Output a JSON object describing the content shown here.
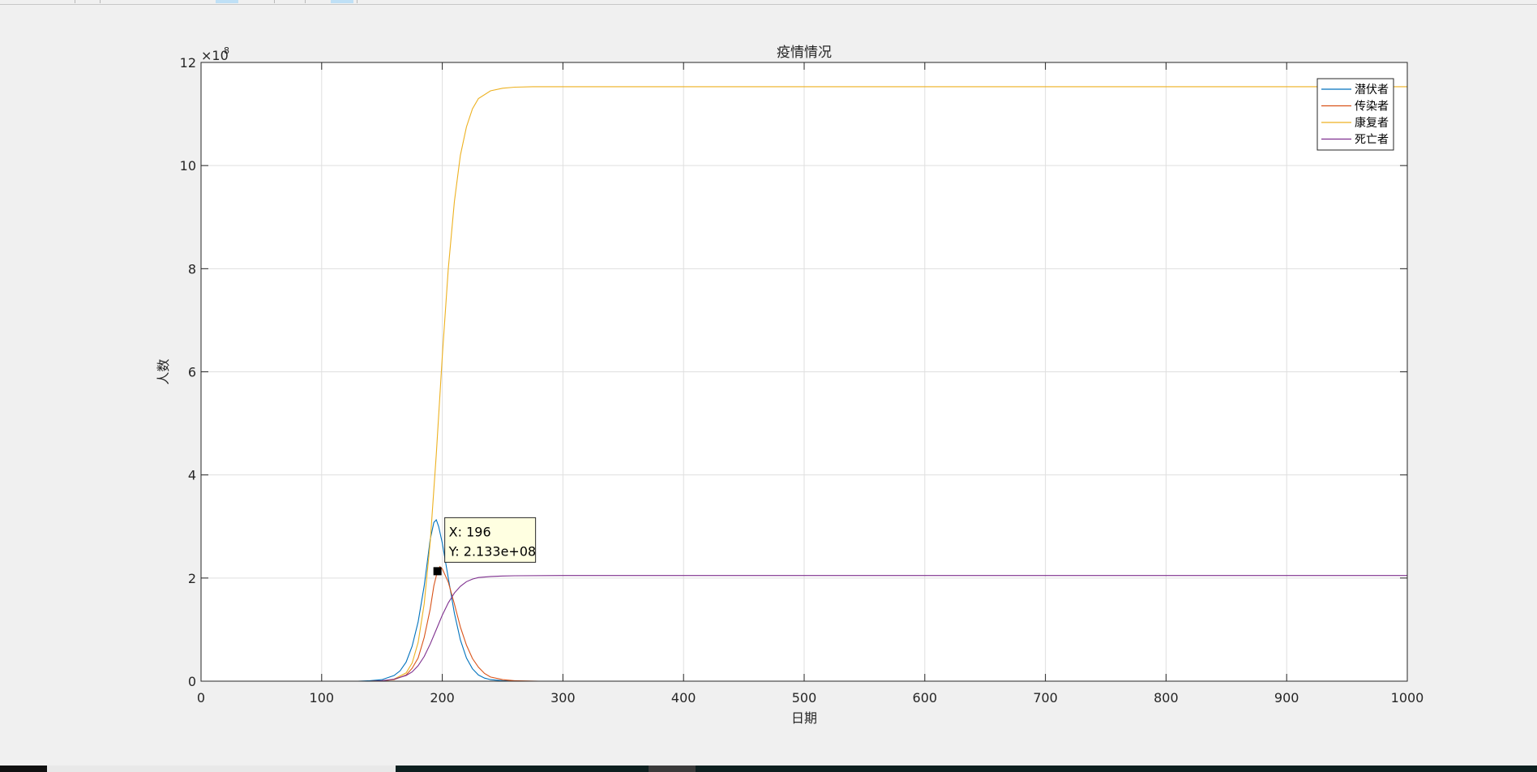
{
  "colors": {
    "series": [
      "#0072BD",
      "#D95319",
      "#EDB120",
      "#7E2F8E"
    ],
    "grid": "#dfdfdf",
    "axis": "#262626",
    "tooltip_bg": "#ffffe1",
    "background": "#f0f0f0"
  },
  "chart_data": {
    "type": "line",
    "title": "疫情情况",
    "xlabel": "日期",
    "ylabel": "人数",
    "y_exponent": "8",
    "y_multiplier_prefix": "×10",
    "xlim": [
      0,
      1000
    ],
    "ylim": [
      0,
      1200000000
    ],
    "grid": true,
    "legend_position": "top-right",
    "x_ticks": [
      0,
      100,
      200,
      300,
      400,
      500,
      600,
      700,
      800,
      900,
      1000
    ],
    "x_tick_labels": [
      "0",
      "100",
      "200",
      "300",
      "400",
      "500",
      "600",
      "700",
      "800",
      "900",
      "1000"
    ],
    "y_ticks": [
      0,
      200000000,
      400000000,
      600000000,
      800000000,
      1000000000,
      1200000000
    ],
    "y_tick_labels": [
      "0",
      "2",
      "4",
      "6",
      "8",
      "10",
      "12"
    ],
    "series": [
      {
        "name": "潜伏者",
        "color_index": 0,
        "points": [
          [
            20,
            0
          ],
          [
            130,
            0
          ],
          [
            140,
            1000000
          ],
          [
            150,
            3000000
          ],
          [
            160,
            11000000
          ],
          [
            165,
            20000000
          ],
          [
            170,
            37000000
          ],
          [
            175,
            68000000
          ],
          [
            180,
            115000000
          ],
          [
            185,
            185000000
          ],
          [
            190,
            275000000
          ],
          [
            193,
            308000000
          ],
          [
            195,
            313000000
          ],
          [
            197,
            300000000
          ],
          [
            200,
            268000000
          ],
          [
            205,
            200000000
          ],
          [
            210,
            132000000
          ],
          [
            215,
            80000000
          ],
          [
            220,
            45000000
          ],
          [
            225,
            24000000
          ],
          [
            230,
            12000000
          ],
          [
            235,
            6000000
          ],
          [
            240,
            3000000
          ],
          [
            250,
            1000000
          ],
          [
            260,
            0
          ],
          [
            1000,
            0
          ]
        ]
      },
      {
        "name": "传染者",
        "color_index": 1,
        "points": [
          [
            20,
            0
          ],
          [
            140,
            0
          ],
          [
            150,
            1000000
          ],
          [
            160,
            3000000
          ],
          [
            170,
            12000000
          ],
          [
            175,
            25000000
          ],
          [
            180,
            45000000
          ],
          [
            185,
            85000000
          ],
          [
            190,
            140000000
          ],
          [
            193,
            185000000
          ],
          [
            196,
            213300000
          ],
          [
            198,
            222000000
          ],
          [
            200,
            218000000
          ],
          [
            205,
            192000000
          ],
          [
            210,
            150000000
          ],
          [
            215,
            105000000
          ],
          [
            220,
            70000000
          ],
          [
            225,
            44000000
          ],
          [
            230,
            27000000
          ],
          [
            235,
            15000000
          ],
          [
            240,
            8000000
          ],
          [
            250,
            3000000
          ],
          [
            260,
            1000000
          ],
          [
            280,
            0
          ],
          [
            1000,
            0
          ]
        ]
      },
      {
        "name": "康复者",
        "color_index": 2,
        "points": [
          [
            20,
            0
          ],
          [
            150,
            0
          ],
          [
            160,
            4000000
          ],
          [
            170,
            16000000
          ],
          [
            175,
            35000000
          ],
          [
            180,
            75000000
          ],
          [
            185,
            150000000
          ],
          [
            190,
            270000000
          ],
          [
            195,
            440000000
          ],
          [
            200,
            630000000
          ],
          [
            205,
            800000000
          ],
          [
            210,
            930000000
          ],
          [
            215,
            1020000000
          ],
          [
            220,
            1075000000
          ],
          [
            225,
            1110000000
          ],
          [
            230,
            1130000000
          ],
          [
            240,
            1145000000
          ],
          [
            250,
            1150000000
          ],
          [
            260,
            1152000000
          ],
          [
            275,
            1153000000
          ],
          [
            300,
            1153000000
          ],
          [
            1000,
            1153000000
          ]
        ]
      },
      {
        "name": "死亡者",
        "color_index": 3,
        "points": [
          [
            20,
            0
          ],
          [
            140,
            0
          ],
          [
            150,
            1000000
          ],
          [
            160,
            4000000
          ],
          [
            170,
            11000000
          ],
          [
            175,
            18000000
          ],
          [
            180,
            30000000
          ],
          [
            185,
            48000000
          ],
          [
            190,
            72000000
          ],
          [
            195,
            100000000
          ],
          [
            200,
            128000000
          ],
          [
            205,
            152000000
          ],
          [
            210,
            171000000
          ],
          [
            215,
            184000000
          ],
          [
            220,
            193000000
          ],
          [
            225,
            198000000
          ],
          [
            230,
            201000000
          ],
          [
            240,
            203000000
          ],
          [
            250,
            204000000
          ],
          [
            260,
            204500000
          ],
          [
            300,
            205000000
          ],
          [
            1000,
            205000000
          ]
        ]
      }
    ],
    "datatip": {
      "x": 196,
      "y": 213300000,
      "line1": "X: 196",
      "line2": "Y: 2.133e+08"
    }
  }
}
